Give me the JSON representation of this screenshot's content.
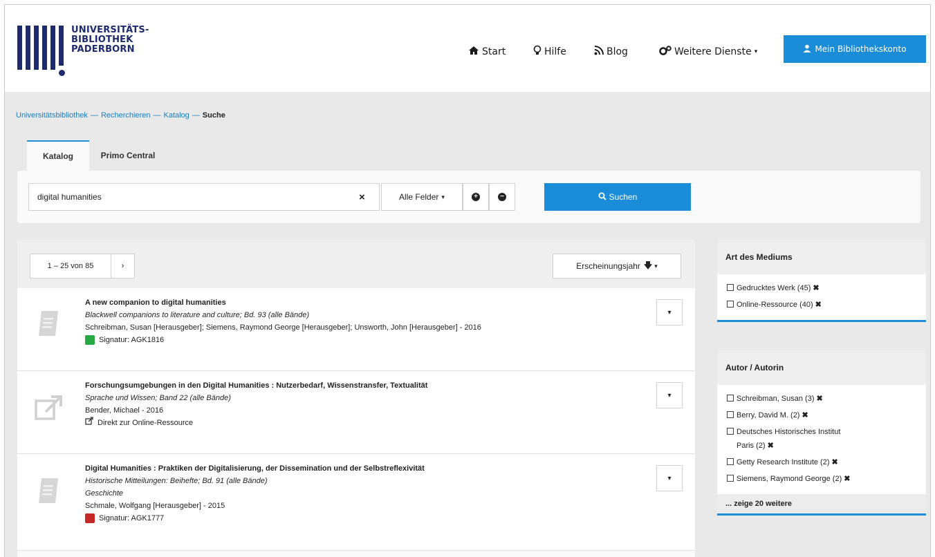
{
  "logo": {
    "line1": "UNIVERSITÄTS-",
    "line2": "BIBLIOTHEK",
    "line3": "PADERBORN"
  },
  "nav": {
    "start": "Start",
    "help": "Hilfe",
    "blog": "Blog",
    "services": "Weitere Dienste",
    "account": "Mein Bibliothekskonto"
  },
  "breadcrumb": {
    "root": "Universitätsbibliothek",
    "sep": "—",
    "research": "Recherchieren",
    "catalog": "Katalog",
    "current": "Suche"
  },
  "tabs": {
    "catalog": "Katalog",
    "primo": "Primo Central"
  },
  "search": {
    "value": "digital humanities",
    "clear": "×",
    "field": "Alle Felder",
    "button": "Suchen"
  },
  "results": {
    "pager": "1 – 25 von 85",
    "next": "›",
    "sort": "Erscheinungsjahr",
    "items": [
      {
        "title": "A new companion to digital humanities",
        "series": "Blackwell companions to literature and culture; Bd. 93 (alle Bände)",
        "genre": "",
        "authors": "Schreibman, Susan [Herausgeber]; Siemens, Raymond George [Herausgeber]; Unsworth, John [Herausgeber] - 2016",
        "link": "Signatur: AGK1816"
      },
      {
        "title": "Forschungsumgebungen in den Digital Humanities : Nutzerbedarf, Wissenstransfer, Textualität",
        "series": "Sprache und Wissen; Band 22 (alle Bände)",
        "genre": "",
        "authors": "Bender, Michael - 2016",
        "link": "Direkt zur Online-Ressource"
      },
      {
        "title": "Digital Humanities : Praktiken der Digitalisierung, der Dissemination und der Selbstreflexivität",
        "series": "Historische Mitteilungen: Beihefte; Bd. 91 (alle Bände)",
        "genre": "Geschichte",
        "authors": "Schmale, Wolfgang [Herausgeber] - 2015",
        "link": "Signatur: AGK1777"
      }
    ]
  },
  "facets": {
    "medium": {
      "title": "Art des Mediums",
      "items": [
        "Gedrucktes Werk (45)",
        "Online-Ressource (40)"
      ]
    },
    "author": {
      "title": "Autor / Autorin",
      "items": [
        "Schreibman, Susan (3)",
        "Berry, David M. (2)",
        "Deutsches Historisches Institut",
        "Paris (2)",
        "Getty Research Institute (2)",
        "Siemens, Raymond George (2)"
      ],
      "more": "... zeige 20 weitere"
    }
  },
  "colors": {
    "brand": "#1e2a6e",
    "accent": "#1a8cd8",
    "available": "#27a844",
    "unavailable": "#c62828"
  }
}
